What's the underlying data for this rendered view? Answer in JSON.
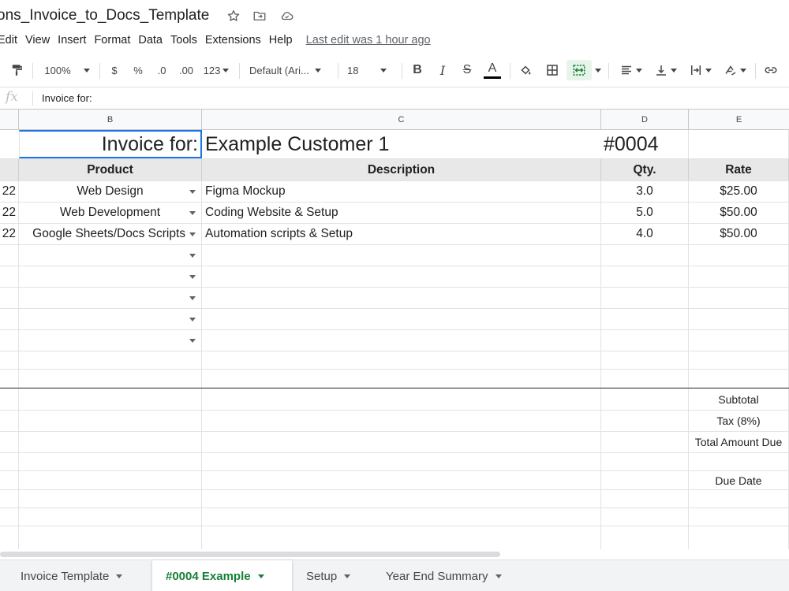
{
  "document": {
    "title": "ons_Invoice_to_Docs_Template"
  },
  "menu": {
    "items": [
      "Edit",
      "View",
      "Insert",
      "Format",
      "Data",
      "Tools",
      "Extensions",
      "Help"
    ],
    "last_edit": "Last edit was 1 hour ago"
  },
  "toolbar": {
    "zoom": "100%",
    "currency": "$",
    "percent": "%",
    "decrease_decimal": ".0",
    "increase_decimal": ".00",
    "number_format": "123",
    "font": "Default (Ari...",
    "font_size": "18",
    "bold": "B",
    "italic": "I",
    "strikethrough": "S",
    "text_color": "A",
    "text_color_bar": "#000000",
    "merge_highlight": "#e6f4ea"
  },
  "formula_bar": {
    "fx": "fx",
    "value": "Invoice for:"
  },
  "columns": [
    "B",
    "C",
    "D",
    "E"
  ],
  "invoice": {
    "label": "Invoice for:",
    "customer": "Example Customer 1",
    "number": "#0004"
  },
  "table_headers": {
    "product": "Product",
    "description": "Description",
    "qty": "Qty.",
    "rate": "Rate"
  },
  "items": [
    {
      "date_fragment": "22",
      "product": "Web Design",
      "description": "Figma Mockup",
      "qty": "3.0",
      "rate": "$25.00"
    },
    {
      "date_fragment": "22",
      "product": "Web Development",
      "description": "Coding Website & Setup",
      "qty": "5.0",
      "rate": "$50.00"
    },
    {
      "date_fragment": "22",
      "product": "Google Sheets/Docs Scripts",
      "description": "Automation scripts & Setup",
      "qty": "4.0",
      "rate": "$50.00"
    }
  ],
  "summary": {
    "subtotal": "Subtotal",
    "tax": "Tax (8%)",
    "total": "Total Amount Due",
    "due_date": "Due Date"
  },
  "sheets": [
    {
      "name": "Invoice Template",
      "active": false
    },
    {
      "name": "#0004 Example",
      "active": true
    },
    {
      "name": "Setup",
      "active": false
    },
    {
      "name": "Year End Summary",
      "active": false
    }
  ],
  "colors": {
    "active_tab": "#188038",
    "header_row_bg": "#e8e8e8",
    "grid_line": "#e2e2e3"
  }
}
